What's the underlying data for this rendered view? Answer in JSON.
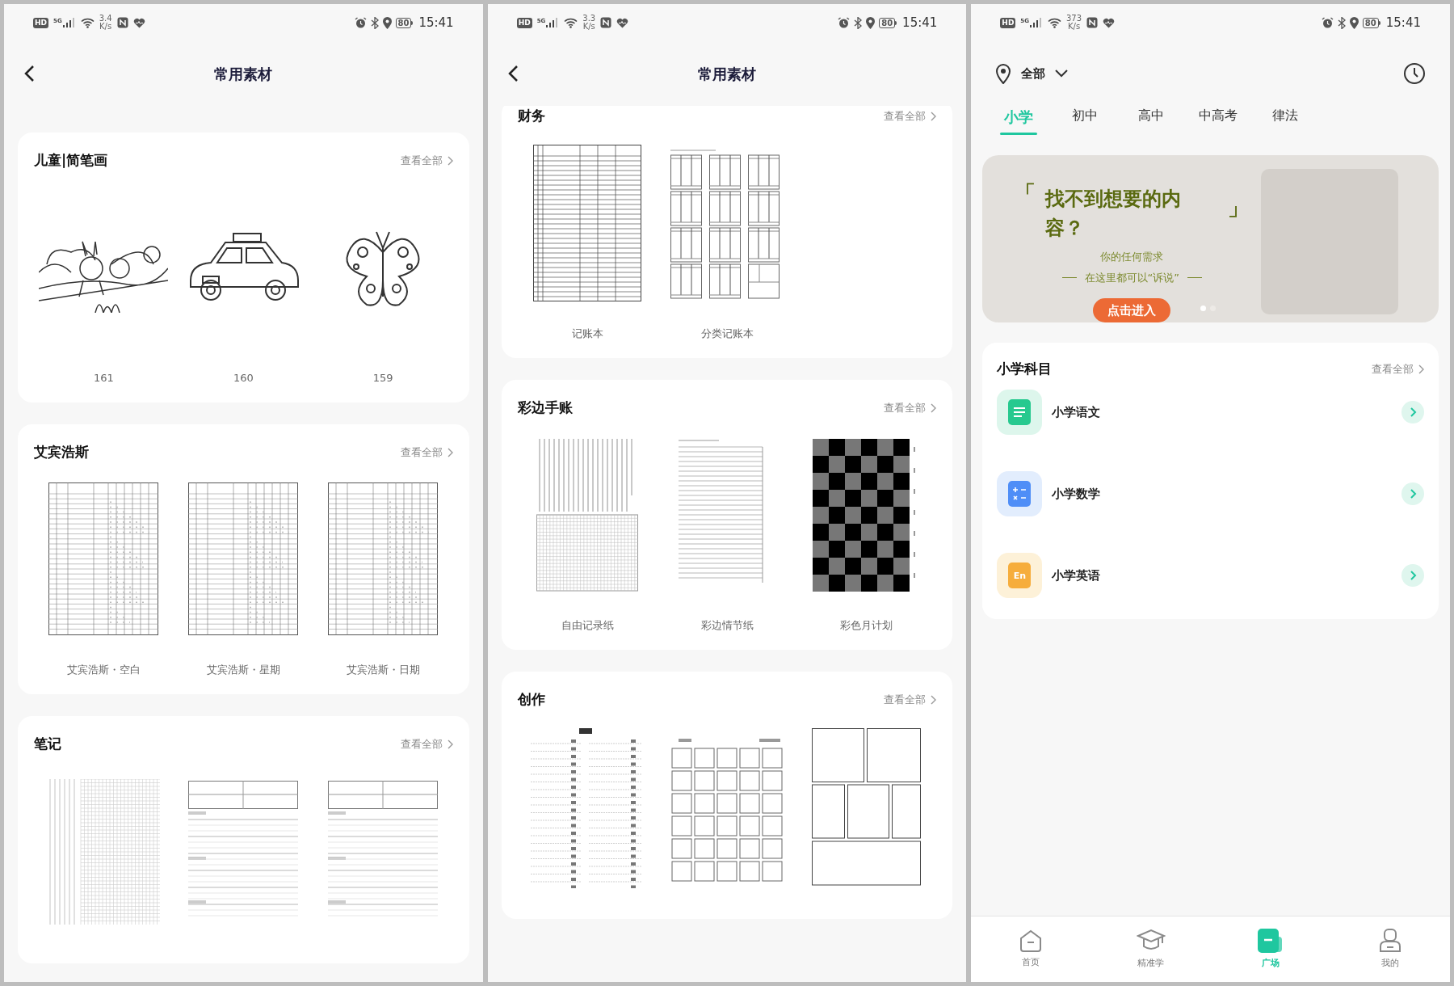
{
  "left_screen": {
    "status_bar": {
      "hd": "HD",
      "network": "5G",
      "speed": "3.4",
      "unit": "K/s",
      "battery": "80",
      "time": "15:41"
    },
    "header": {
      "title": "常用素材"
    },
    "sections": [
      {
        "title": "儿童|简笔画",
        "more": "查看全部",
        "items": [
          {
            "kind": "scene",
            "label": "161"
          },
          {
            "kind": "car",
            "label": "160"
          },
          {
            "kind": "butterfly",
            "label": "159"
          }
        ]
      },
      {
        "title": "艾宾浩斯",
        "more": "查看全部",
        "items": [
          {
            "kind": "table",
            "label": "艾宾浩斯・空白"
          },
          {
            "kind": "table",
            "label": "艾宾浩斯・星期"
          },
          {
            "kind": "table",
            "label": "艾宾浩斯・日期"
          }
        ]
      },
      {
        "title": "笔记",
        "more": "查看全部",
        "items": [
          {
            "kind": "grid"
          },
          {
            "kind": "form"
          },
          {
            "kind": "form"
          }
        ]
      }
    ]
  },
  "middle_screen": {
    "status_bar": {
      "hd": "HD",
      "network": "5G",
      "speed": "3.3",
      "unit": "K/s",
      "battery": "80",
      "time": "15:41"
    },
    "header": {
      "title": "常用素材"
    },
    "sections": [
      {
        "title": "财务",
        "more": "查看全部",
        "items": [
          {
            "kind": "ledger",
            "label": "记账本"
          },
          {
            "kind": "minitables",
            "label": "分类记账本"
          }
        ]
      },
      {
        "title": "彩边手账",
        "more": "查看全部",
        "items": [
          {
            "kind": "freenote",
            "label": "自由记录纸"
          },
          {
            "kind": "lines",
            "label": "彩边情节纸"
          },
          {
            "kind": "checker",
            "label": "彩色月计划"
          }
        ]
      },
      {
        "title": "创作",
        "more": "查看全部",
        "items": [
          {
            "kind": "toc"
          },
          {
            "kind": "boxes"
          },
          {
            "kind": "panels"
          }
        ]
      }
    ]
  },
  "right_screen": {
    "status_bar": {
      "hd": "HD",
      "network": "5G",
      "speed": "373",
      "unit": "K/s",
      "battery": "80",
      "time": "15:41"
    },
    "location": "全部",
    "tabs": [
      {
        "label": "小学",
        "selected": true
      },
      {
        "label": "初中",
        "selected": false
      },
      {
        "label": "高中",
        "selected": false
      },
      {
        "label": "中高考",
        "selected": false
      },
      {
        "label": "律法",
        "selected": false
      }
    ],
    "banner": {
      "headline_open": "「",
      "headline": "找不到想要的内容？",
      "headline_close": "」",
      "line_1": "你的任何需求",
      "line_2": "在这里都可以“诉说”",
      "button": "点击进入",
      "dots": [
        {
          "selected": true
        },
        {
          "selected": false
        }
      ]
    },
    "subjects": {
      "title": "小学科目",
      "more": "查看全部",
      "items": [
        {
          "label": "小学语文",
          "kind": "text",
          "color": "#27c98f"
        },
        {
          "label": "小学数学",
          "kind": "math",
          "color": "#4f8ef7"
        },
        {
          "label": "小学英语",
          "kind": "english",
          "color": "#f6ad3c",
          "icon_text": "En"
        }
      ]
    },
    "bottom_nav": [
      {
        "label": "首页",
        "kind": "home",
        "selected": false
      },
      {
        "label": "精准学",
        "kind": "cap",
        "selected": false
      },
      {
        "label": "广场",
        "kind": "square",
        "selected": true
      },
      {
        "label": "我的",
        "kind": "person",
        "selected": false
      }
    ]
  }
}
